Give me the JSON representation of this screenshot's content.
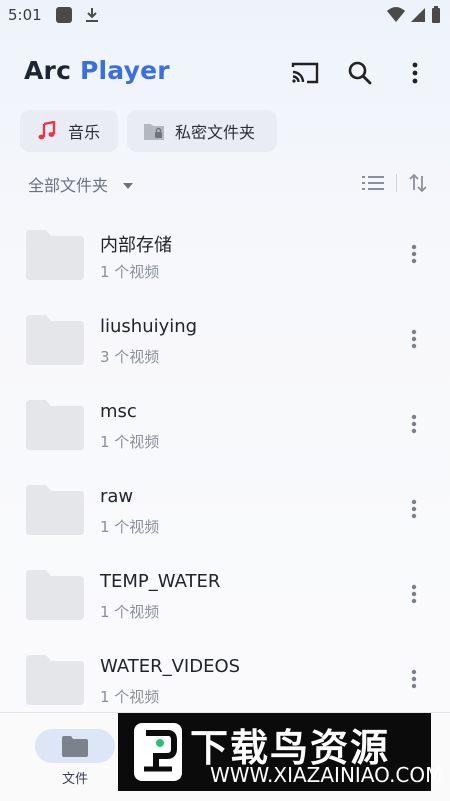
{
  "status_bar": {
    "time": "5:01"
  },
  "header": {
    "logo_part1": "Arc",
    "logo_part2": "Player",
    "accent_color": "#3b6fe0"
  },
  "chips": [
    {
      "label": "音乐",
      "icon": "music-note-icon",
      "icon_color": "#e0394a"
    },
    {
      "label": "私密文件夹",
      "icon": "locked-folder-icon",
      "icon_color": "#9aa0a8"
    }
  ],
  "filter": {
    "label": "全部文件夹"
  },
  "folders": [
    {
      "name": "内部存储",
      "count": "1 个视频"
    },
    {
      "name": "liushuiying",
      "count": "3 个视频"
    },
    {
      "name": "msc",
      "count": "1 个视频"
    },
    {
      "name": "raw",
      "count": "1 个视频"
    },
    {
      "name": "TEMP_WATER",
      "count": "1 个视频"
    },
    {
      "name": "WATER_VIDEOS",
      "count": "1 个视频"
    }
  ],
  "bottom_nav": {
    "files_label": "文件"
  },
  "watermark": {
    "title": "下载鸟资源",
    "url": "WWW.XIAZAINIAO.COM"
  }
}
